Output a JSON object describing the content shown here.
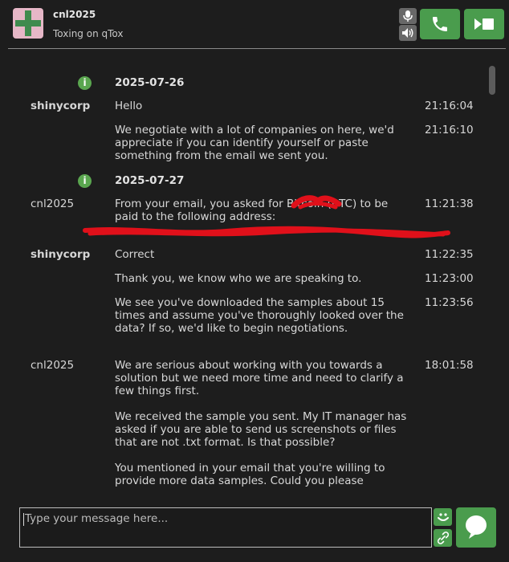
{
  "header": {
    "contact_name": "cnl2025",
    "contact_status": "Toxing on qTox",
    "icons": {
      "mic": "microphone-icon",
      "volume": "speaker-icon",
      "call": "phone-icon",
      "video": "video-call-icon"
    }
  },
  "chat": {
    "dates": [
      "2025-07-26",
      "2025-07-27"
    ],
    "messages": [
      {
        "sender": "shinycorp",
        "text": "Hello",
        "time": "21:16:04"
      },
      {
        "sender": "",
        "text": "We negotiate with a lot of companies on here, we'd appreciate if you can identify yourself or paste something from the email we sent you.",
        "time": "21:16:10"
      },
      {
        "sender": "cnl2025",
        "text": "From your email, you asked for Bitcoin (BTC) to be paid to the following address:",
        "time": "11:21:38"
      },
      {
        "sender": "shinycorp",
        "text": "Correct",
        "time": "11:22:35"
      },
      {
        "sender": "",
        "text": "Thank you, we know who we are speaking to.",
        "time": "11:23:00"
      },
      {
        "sender": "",
        "text": "We see you've downloaded the samples about 15 times and assume you've thoroughly looked over the data? If so, we'd like to begin negotiations.",
        "time": "11:23:56"
      },
      {
        "sender": "cnl2025",
        "text": "We are serious about working with you towards a solution but we need more time and need to clarify a few things first.\n\nWe received the sample you sent. My IT manager has asked if you are able to send us screenshots or files that are not .txt format. Is that possible?\n\nYou mentioned in your email that you're willing to provide more data samples. Could you please",
        "time": "18:01:58"
      }
    ]
  },
  "composer": {
    "placeholder": "Type your message here...",
    "icons": {
      "emoji": "emoji-smile-icon",
      "attach": "paperclip-icon",
      "send": "speech-bubble-send-icon"
    }
  },
  "colors": {
    "background": "#1d1d1d",
    "accent_green": "#4a9c4d",
    "avatar_pink": "#e6b7c7",
    "redaction_red": "#e0101a"
  }
}
